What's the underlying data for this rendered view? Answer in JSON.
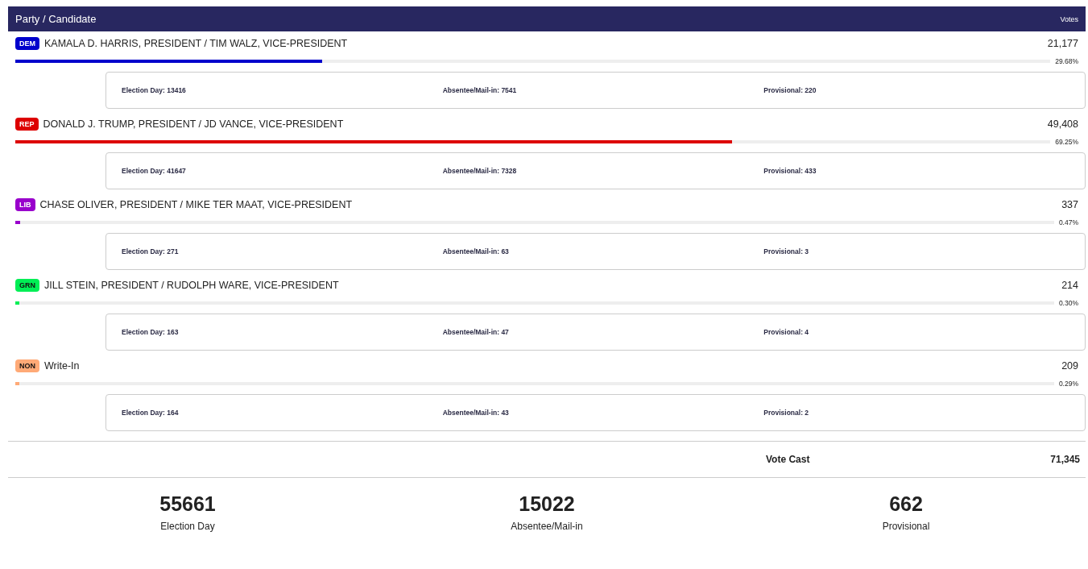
{
  "header": {
    "party_candidate": "Party / Candidate",
    "votes": "Votes"
  },
  "candidates": [
    {
      "party": "DEM",
      "color": "#0000cc",
      "name": "KAMALA D. HARRIS, PRESIDENT / TIM WALZ, VICE-PRESIDENT",
      "votes": "21,177",
      "level": 0.2968,
      "percent": "29.68%",
      "breakdown": [
        "Election Day: 13416",
        "Absentee/Mail-in: 7541",
        "Provisional: 220"
      ]
    },
    {
      "party": "REP",
      "color": "#dd0000",
      "name": "DONALD J. TRUMP, PRESIDENT / JD VANCE, VICE-PRESIDENT",
      "votes": "49,408",
      "level": 0.6925,
      "percent": "69.25%",
      "breakdown": [
        "Election Day: 41647",
        "Absentee/Mail-in: 7328",
        "Provisional: 433"
      ]
    },
    {
      "party": "LIB",
      "color": "#9900cc",
      "name": "CHASE OLIVER, PRESIDENT / MIKE TER MAAT, VICE-PRESIDENT",
      "votes": "337",
      "level": 0.0047,
      "percent": "0.47%",
      "breakdown": [
        "Election Day: 271",
        "Absentee/Mail-in: 63",
        "Provisional: 3"
      ]
    },
    {
      "party": "GRN",
      "color": "#00ee55",
      "name": "JILL STEIN, PRESIDENT / RUDOLPH WARE, VICE-PRESIDENT",
      "votes": "214",
      "level": 0.003,
      "percent": "0.30%",
      "breakdown": [
        "Election Day: 163",
        "Absentee/Mail-in: 47",
        "Provisional: 4"
      ]
    },
    {
      "party": "NON",
      "color": "#ffaa77",
      "name": "Write-In",
      "votes": "209",
      "level": 0.0029,
      "percent": "0.29%",
      "breakdown": [
        "Election Day: 164",
        "Absentee/Mail-in: 43",
        "Provisional: 2"
      ]
    }
  ],
  "total": {
    "label": "Vote Cast",
    "value": "71,345"
  },
  "summary": [
    {
      "value": "55661",
      "label": "Election Day"
    },
    {
      "value": "15022",
      "label": "Absentee/Mail-in"
    },
    {
      "value": "662",
      "label": "Provisional"
    }
  ]
}
